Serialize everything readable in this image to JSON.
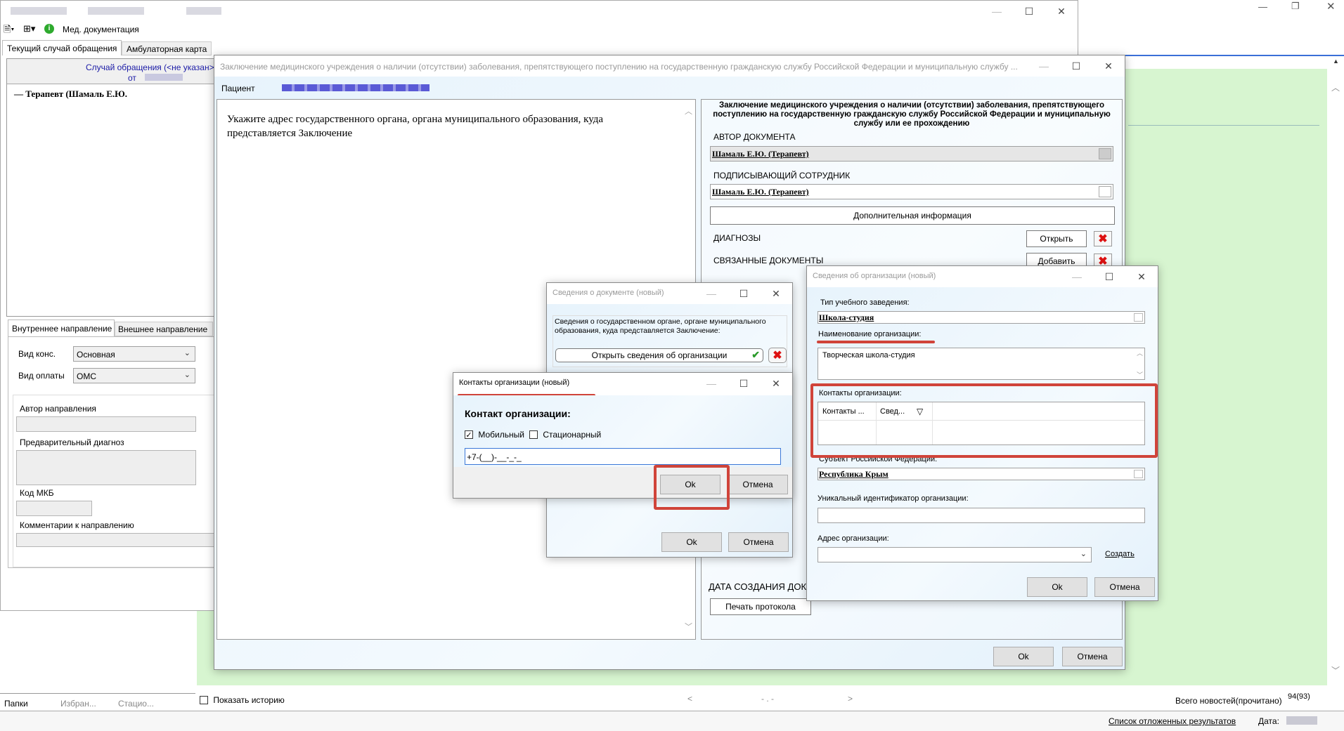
{
  "colors": {
    "green_panel": "#d7f5d0",
    "highlight_red": "#d0443a",
    "link_blue": "#1a1aa6"
  },
  "toolbar": {
    "med_docs": "Мед. документация"
  },
  "main_tabs": [
    "Текущий случай обращения",
    "Амбулаторная карта"
  ],
  "case": {
    "title": "Случай обращения (<не указан>",
    "from": "от",
    "tree_item": "Терапевт (Шамаль Е.Ю."
  },
  "direction_tabs": [
    "Внутреннее направление",
    "Внешнее направление"
  ],
  "direction": {
    "cons_type_label": "Вид конс.",
    "cons_type_value": "Основная",
    "payment_label": "Вид оплаты",
    "payment_value": "ОМС",
    "author_label": "Автор направления",
    "prelim_diag_label": "Предварительный диагноз",
    "mkb_label": "Код МКБ",
    "comment_label": "Комментарии к направлению"
  },
  "bottom_left_tabs": [
    "Папки",
    "Избран...",
    "Стацио..."
  ],
  "bottom_bar": {
    "show_history": "Показать историю",
    "nav_prev": "<",
    "nav_mid": "- . -",
    "nav_next": ">",
    "news_label": "Всего новостей(прочитано)",
    "news_count": "94(93)",
    "deferred_link": "Список отложенных результатов",
    "date_label": "Дата:"
  },
  "conclusion_window": {
    "title": "Заключение медицинского учреждения о наличии (отсутствии) заболевания, препятствующего поступлению на государственную гражданскую службу Российской Федерации и муниципальную службу ...",
    "patient_label": "Пациент",
    "instruction": "Укажите адрес государственного органа, органа муниципального образования, куда представляется Заключение",
    "doc_header": "Заключение медицинского учреждения о наличии (отсутствии) заболевания, препятствующего поступлению на государственную гражданскую службу Российской Федерации и муниципальную службу или ее прохождению",
    "author_label": "АВТОР ДОКУМЕНТА",
    "author_value": "Шамаль Е.Ю. (Терапевт)",
    "signer_label": "ПОДПИСЫВАЮЩИЙ СОТРУДНИК",
    "signer_value": "Шамаль Е.Ю. (Терапевт)",
    "extra_info_button": "Дополнительная информация",
    "diagnoses_label": "ДИАГНОЗЫ",
    "open_button": "Открыть",
    "linked_docs_label": "СВЯЗАННЫЕ ДОКУМЕНТЫ",
    "add_button": "Добавить",
    "creation_date_label": "ДАТА СОЗДАНИЯ ДОКУМ",
    "print_button": "Печать протокола",
    "ok": "Ok",
    "cancel": "Отмена"
  },
  "doc_info_dialog": {
    "title": "Сведения о документе (новый)",
    "description": "Сведения о государственном органе, органе муниципального образования, куда представляется Заключение:",
    "open_org_button": "Открыть сведения об организации",
    "ok": "Ok",
    "cancel": "Отмена"
  },
  "contacts_dialog": {
    "title": "Контакты организации (новый)",
    "heading": "Контакт организации:",
    "mobile_label": "Мобильный",
    "landline_label": "Стационарный",
    "phone_value": "+7-(__)-__-_-_",
    "ok": "Ok",
    "cancel": "Отмена"
  },
  "org_dialog": {
    "title": "Сведения об организации (новый)",
    "edu_type_label": "Тип учебного заведения:",
    "edu_type_value": "Школа-студия",
    "org_name_label": "Наименование организации:",
    "org_name_value": "Творческая школа-студия",
    "contacts_label": "Контакты организации:",
    "contacts_col1": "Контакты ...",
    "contacts_col2": "Свед...",
    "subject_label": "Субъект Российской Федерации:",
    "subject_value": "Республика Крым",
    "uid_label": "Уникальный идентификатор организации:",
    "address_label": "Адрес организации:",
    "create_link": "Создать",
    "ok": "Ok",
    "cancel": "Отмена"
  }
}
